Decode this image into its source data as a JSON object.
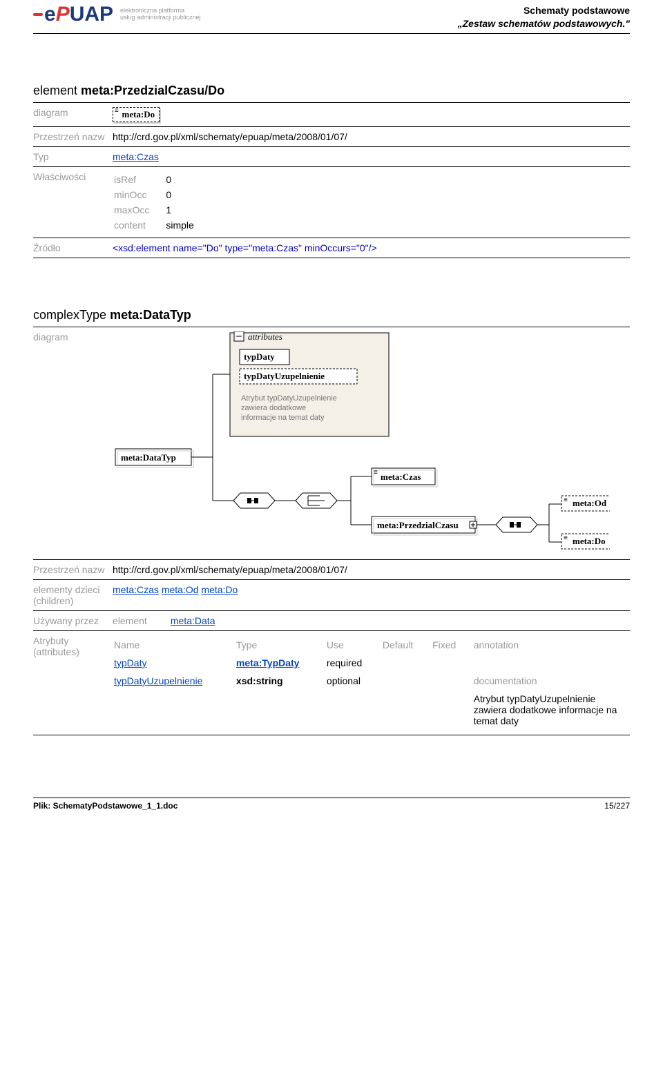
{
  "header": {
    "logo_subtitle_l1": "elektroniczna platforma",
    "logo_subtitle_l2": "usług administracji publicznej",
    "right_l1": "Schematy podstawowe",
    "right_l2": "„Zestaw schematów podstawowych.\""
  },
  "section1": {
    "prefix": "element ",
    "name": "meta:PrzedzialCzasu/Do",
    "rows": {
      "diagram_label": "diagram",
      "diag_box": "meta:Do",
      "ns_label": "Przestrzeń nazw",
      "ns_value": "http://crd.gov.pl/xml/schematy/epuap/meta/2008/01/07/",
      "typ_label": "Typ",
      "typ_value": "meta:Czas",
      "props_label": "Właściwości",
      "props": {
        "isRef": "0",
        "minOcc": "0",
        "maxOcc": "1",
        "content": "simple"
      },
      "src_label": "Źródło",
      "src_value": "<xsd:element name=\"Do\" type=\"meta:Czas\" minOccurs=\"0\"/>"
    }
  },
  "section2": {
    "prefix": "complexType ",
    "name": "meta:DataTyp",
    "diagram_label": "diagram",
    "diag": {
      "root": "meta:DataTyp",
      "attributes_label": "attributes",
      "attr1": "typDaty",
      "attr2": "typDatyUzupelnienie",
      "note_l1": "Atrybut typDatyUzupelnienie",
      "note_l2": "zawiera dodatkowe",
      "note_l3": "informacje na temat daty",
      "metaCzas": "meta:Czas",
      "przedzial": "meta:PrzedzialCzasu",
      "metaOd": "meta:Od",
      "metaDo": "meta:Do"
    },
    "ns_label": "Przestrzeń nazw",
    "ns_value": "http://crd.gov.pl/xml/schematy/epuap/meta/2008/01/07/",
    "children_label": "elementy dzieci (children)",
    "children": [
      "meta:Czas",
      "meta:Od",
      "meta:Do"
    ],
    "usedby_label": "Używany przez",
    "usedby_kind": "element",
    "usedby_value": "meta:Data",
    "attrs_label": "Atrybuty (attributes)",
    "attr_headers": [
      "Name",
      "Type",
      "Use",
      "Default",
      "Fixed",
      "annotation"
    ],
    "attr_rows": [
      {
        "name": "typDaty",
        "type": "meta:TypDaty",
        "use": "required",
        "default": "",
        "fixed": "",
        "annotation": ""
      },
      {
        "name": "typDatyUzupelnienie",
        "type": "xsd:string",
        "use": "optional",
        "default": "",
        "fixed": "",
        "annotation": "documentation"
      }
    ],
    "doc_note": "Atrybut typDatyUzupelnienie zawiera dodatkowe informacje na temat daty"
  },
  "footer": {
    "left": "Plik: SchematyPodstawowe_1_1.doc",
    "right": "15/227"
  }
}
